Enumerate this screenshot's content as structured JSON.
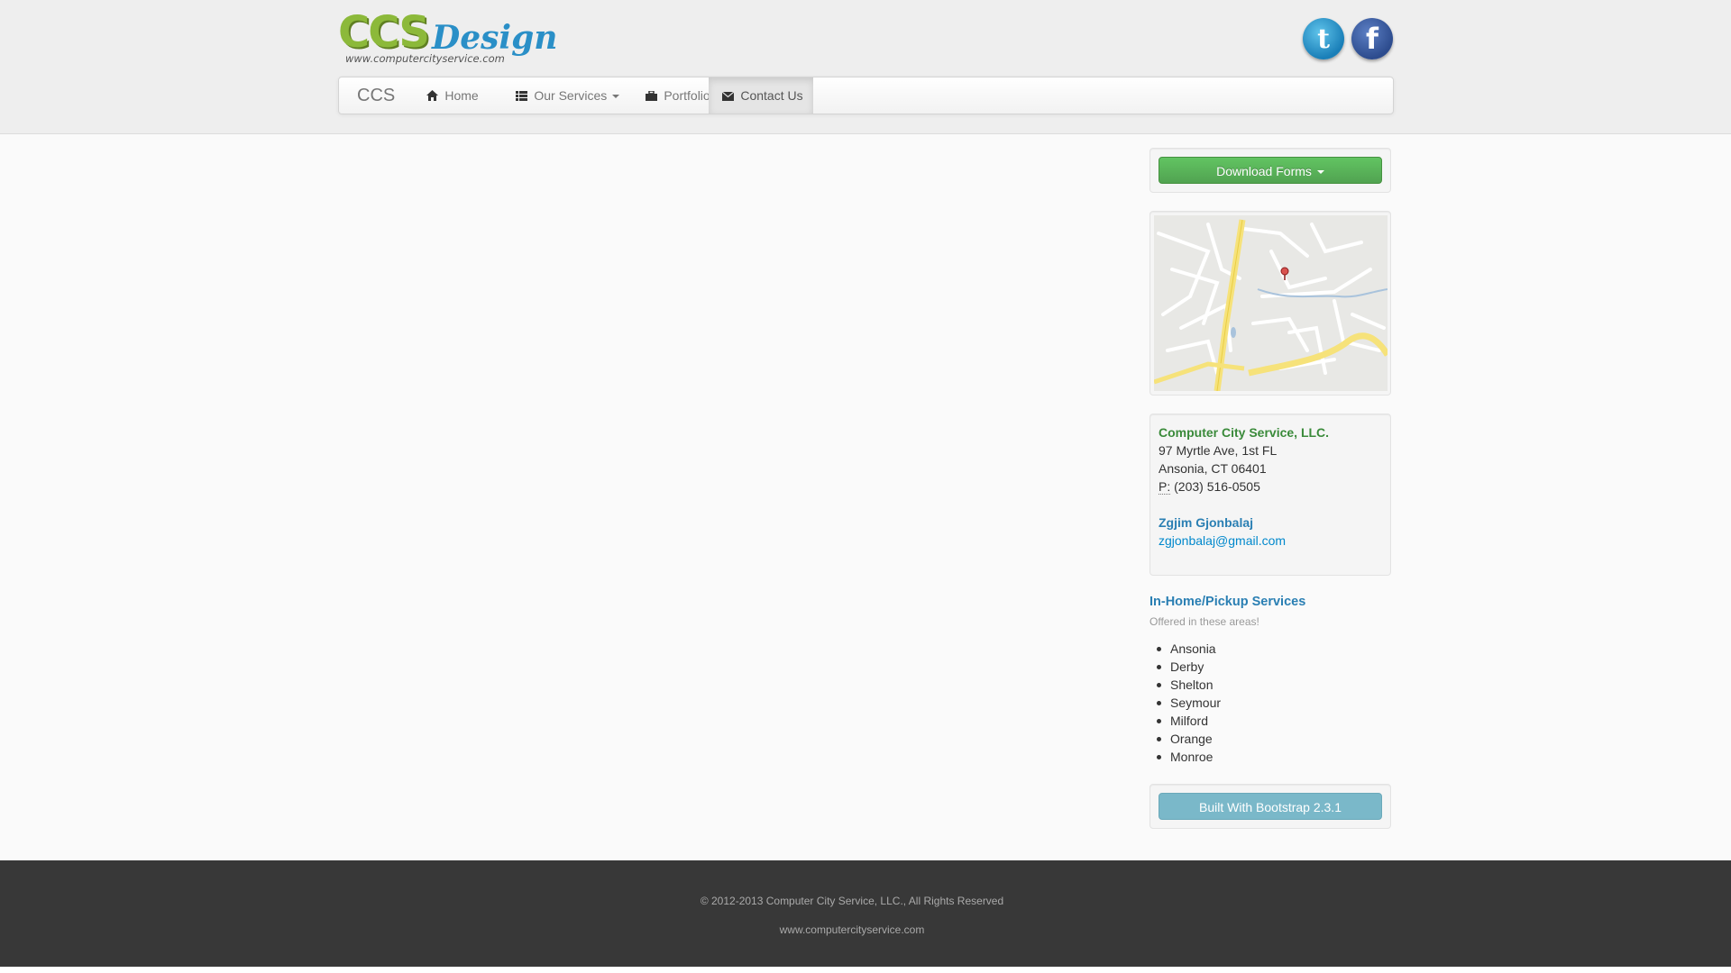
{
  "logo": {
    "mark": "CCS",
    "word": "Design",
    "url": "www.computercityservice.com"
  },
  "social": {
    "twitter_glyph": "t",
    "facebook_glyph": "f"
  },
  "nav": {
    "brand": "CCS",
    "home": "Home",
    "services": "Our Services",
    "portfolio": "Portfolio",
    "contact": "Contact Us",
    "active": "Contact Us"
  },
  "icons": {
    "home": "home-icon",
    "services": "list-icon",
    "portfolio": "briefcase-icon",
    "contact": "envelope-icon"
  },
  "sidebar": {
    "download_forms": "Download Forms",
    "built_with": "Built With Bootstrap 2.3.1"
  },
  "contact": {
    "company": "Computer City Service, LLC.",
    "street": "97 Myrtle Ave, 1st FL",
    "city": "Ansonia, CT 06401",
    "phone_label": "P:",
    "phone": "(203) 516-0505",
    "person": "Zgjim Gjonbalaj",
    "email": "zgjonbalaj@gmail.com"
  },
  "services": {
    "title": "In-Home/Pickup Services",
    "subtitle": "Offered in these areas!",
    "areas": [
      "Ansonia",
      "Derby",
      "Shelton",
      "Seymour",
      "Milford",
      "Orange",
      "Monroe"
    ]
  },
  "footer": {
    "copyright": "© 2012-2013 Computer City Service, LLC., All Rights Reserved",
    "site": "www.computercityservice.com"
  },
  "colors": {
    "accent_green": "#5bb75b",
    "accent_blue": "#2a7fb3",
    "footer_bg": "#383838"
  }
}
